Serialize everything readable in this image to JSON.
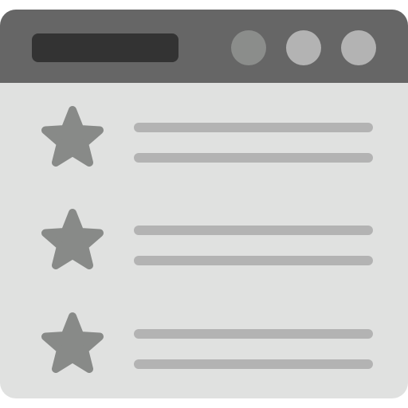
{
  "colors": {
    "titlebar": "#666666",
    "address_bar": "#333333",
    "body": "#e0e1e0",
    "control_1": "#8b8d8b",
    "control_2": "#b3b3b3",
    "control_3": "#b3b3b3",
    "star": "#888a88",
    "line": "#b3b3b3"
  },
  "titlebar": {
    "icons": [
      "minimize-circle",
      "maximize-circle",
      "close-circle"
    ]
  },
  "list": {
    "items": [
      {
        "icon": "star-icon",
        "lines": 2
      },
      {
        "icon": "star-icon",
        "lines": 2
      },
      {
        "icon": "star-icon",
        "lines": 2
      }
    ]
  }
}
